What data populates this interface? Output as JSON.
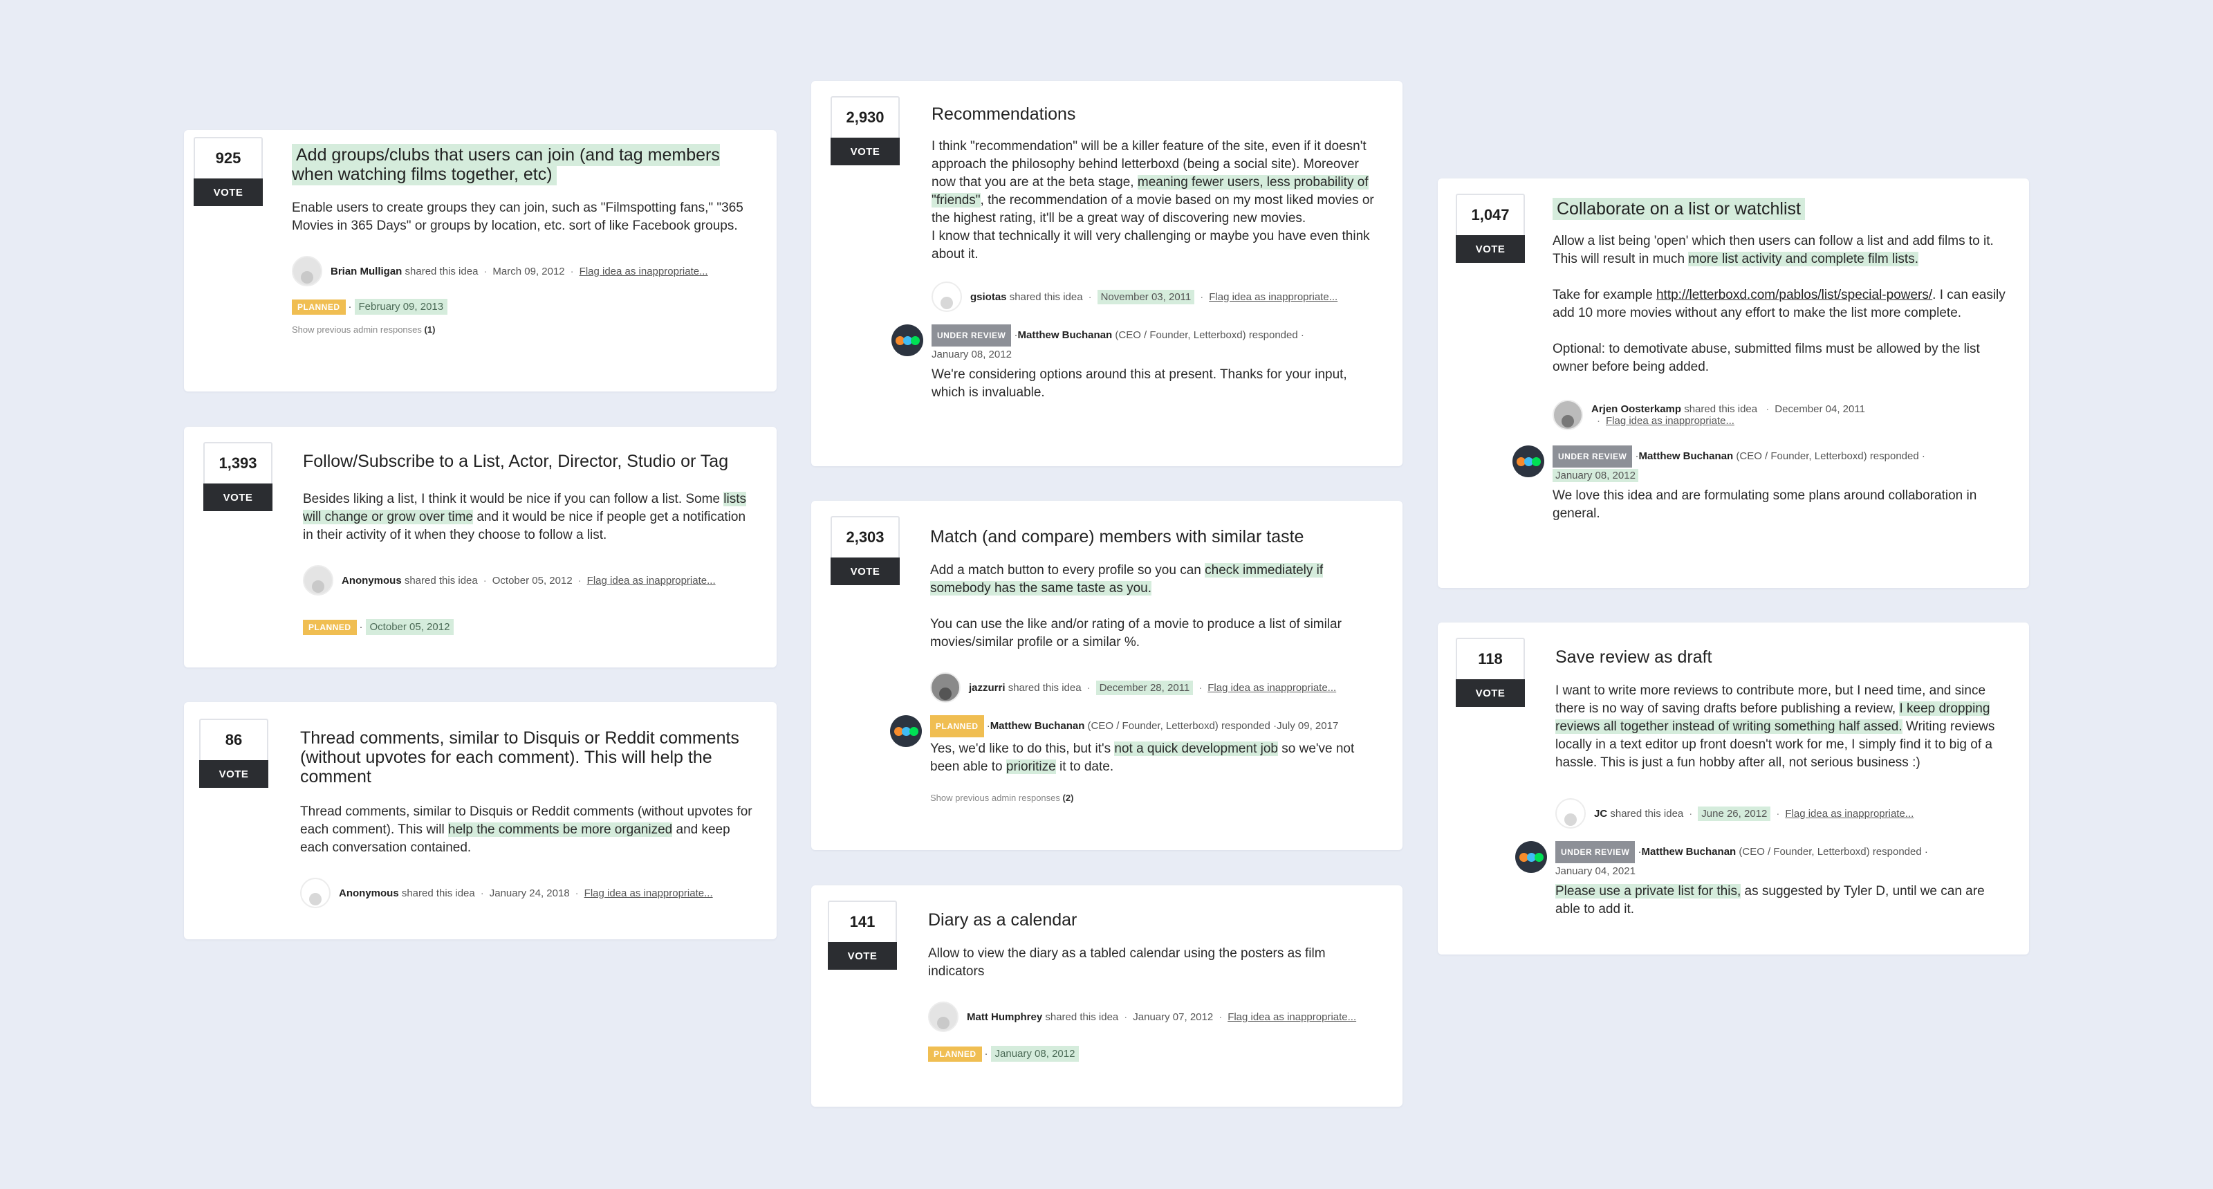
{
  "colors": {
    "highlight": "#d5ecdc",
    "planned": "#f0be52",
    "under_review": "#8d9097",
    "vote": "#2b2d31",
    "background": "#e8ecf5"
  },
  "vote_label": "VOTE",
  "shared_text": "shared this idea",
  "flag_text": "Flag idea as inappropriate...",
  "responded_text": "responded",
  "admin_name": "Matthew Buchanan",
  "admin_role": "(CEO / Founder, Letterboxd)",
  "cards": {
    "groups": {
      "votes": "925",
      "title": "Add groups/clubs that users can join (and tag members when watching films together, etc)",
      "body": "Enable users to create groups they can join, such as \"Filmspotting fans,\" \"365 Movies in 365 Days\" or groups by location, etc. sort of like Facebook groups.",
      "author": "Brian Mulligan",
      "date": "March 09, 2012",
      "status": "PLANNED",
      "status_date": "February 09, 2013",
      "show_prev": "Show previous admin responses",
      "show_prev_count": "(1)"
    },
    "follow": {
      "votes": "1,393",
      "title": "Follow/Subscribe to a List, Actor, Director, Studio or Tag",
      "body_a": "Besides liking a list, I think it would be nice if you can follow a list. Some ",
      "body_hl": "lists will change or grow over time",
      "body_b": " and it would be nice if people get a notification in their activity of it when they choose to follow a list.",
      "author": "Anonymous",
      "date": "October 05, 2012",
      "status": "PLANNED",
      "status_date": "October 05, 2012"
    },
    "thread": {
      "votes": "86",
      "title": "Thread comments, similar to Disquis or Reddit comments (without upvotes for each comment). This will help the comment",
      "body_a": "Thread comments, similar to Disquis or Reddit comments (without upvotes for each comment). This will ",
      "body_hl": "help the comments be more organized",
      "body_b": " and keep each conversation contained.",
      "author": "Anonymous",
      "date": "January 24, 2018"
    },
    "recs": {
      "votes": "2,930",
      "title": "Recommendations",
      "body_a": "I think \"recommendation\" will be a killer feature of the site, even if it doesn't approach the philosophy behind letterboxd (being a social site). Moreover now that you are at the beta stage, ",
      "body_hl": "meaning fewer users, less probability of \"friends\"",
      "body_b": ", the recommendation of a movie based on my most liked movies or the highest rating, it'll be a great way of discovering new movies.",
      "body_c": "I know that technically it will very challenging or maybe you have even think about it.",
      "author": "gsiotas",
      "date": "November 03, 2011",
      "status": "UNDER REVIEW",
      "admin_date": "January 08, 2012",
      "admin_text": "We're considering options around this at present. Thanks for your input, which is invaluable."
    },
    "match": {
      "votes": "2,303",
      "title": "Match (and compare) members with similar taste",
      "body_a": "Add a match button to every profile so you can ",
      "body_hl": "check immediately if somebody has the same taste as you.",
      "body_c": "You can use the like and/or rating of a movie to produce a list of similar movies/similar profile or a similar %.",
      "author": "jazzurri",
      "date": "December 28, 2011",
      "status": "PLANNED",
      "admin_date": "July 09, 2017",
      "admin_a": "Yes, we'd like to do this, but it's ",
      "admin_hl1": "not a quick development job",
      "admin_b": " so we've not been able to ",
      "admin_hl2": "prioritize",
      "admin_c": " it to date.",
      "show_prev": "Show previous admin responses",
      "show_prev_count": "(2)"
    },
    "diary": {
      "votes": "141",
      "title": "Diary as a calendar",
      "body": "Allow to view the diary as a tabled calendar using the posters as film indicators",
      "author": "Matt Humphrey",
      "date": "January 07, 2012",
      "status": "PLANNED",
      "status_date": "January 08, 2012"
    },
    "collab": {
      "votes": "1,047",
      "title": "Collaborate on a list or watchlist",
      "body_a": "Allow a list being 'open' which then users can follow a list and add films to it. This will result in much ",
      "body_hl": "more list activity and complete film lists.",
      "body_c1": "Take for example ",
      "body_link": "http://letterboxd.com/pablos/list/special-powers/",
      "body_c2": ". I can easily add 10 more movies without any effort to make the list more complete.",
      "body_d": "Optional: to demotivate abuse, submitted films must be allowed by the list owner before being added.",
      "author": "Arjen Oosterkamp",
      "date": "December 04, 2011",
      "status": "UNDER REVIEW",
      "admin_date": "January 08, 2012",
      "admin_text": "We love this idea and are formulating some plans around collaboration in general."
    },
    "draft": {
      "votes": "118",
      "title": "Save review as draft",
      "body_a": "I want to write more reviews to contribute more, but I need time, and since there is no way of saving drafts before publishing a review, ",
      "body_hl": "I keep dropping reviews all together instead of writing something half assed.",
      "body_b": " Writing reviews locally in a text editor up front doesn't work for me, I simply find it to big of a hassle. This is just a fun hobby after all, not serious business :)",
      "author": "JC",
      "date": "June 26, 2012",
      "status": "UNDER REVIEW",
      "admin_date": "January 04, 2021",
      "admin_hl": "Please use a private list for this,",
      "admin_b": " as suggested by Tyler D, until we can are able to add it."
    }
  }
}
